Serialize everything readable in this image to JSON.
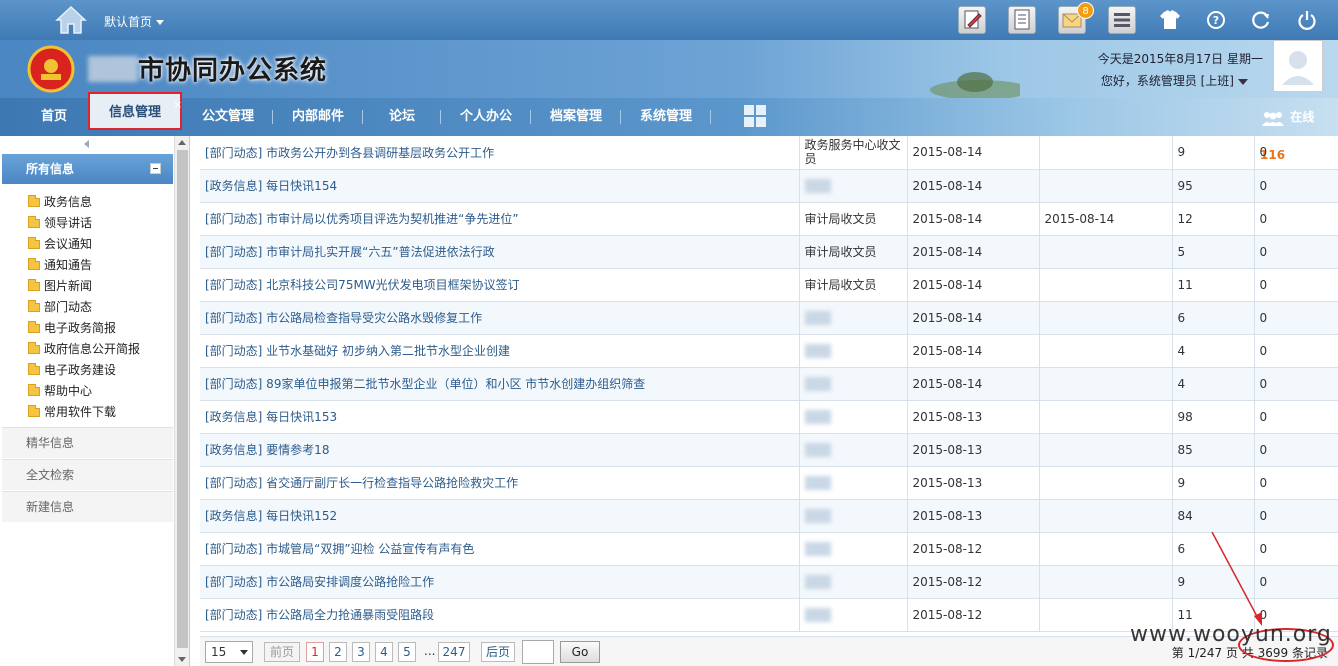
{
  "topbar": {
    "home_label": "默认首页",
    "mail_badge": "8"
  },
  "header": {
    "system_title": "市协同办公系统",
    "date_line": "今天是2015年8月17日 星期一",
    "user_line": "您好，系统管理员 [上班]"
  },
  "nav": {
    "items": [
      "首页",
      "信息管理",
      "公文管理",
      "内部邮件",
      "论坛",
      "个人办公",
      "档案管理",
      "系统管理"
    ],
    "active_close": "×",
    "online_label": "在线",
    "online_count": "116"
  },
  "sidebar": {
    "panel_title": "所有信息",
    "items": [
      "政务信息",
      "领导讲话",
      "会议通知",
      "通知通告",
      "图片新闻",
      "部门动态",
      "电子政务简报",
      "政府信息公开简报",
      "电子政务建设",
      "帮助中心",
      "常用软件下载"
    ],
    "sections": [
      "精华信息",
      "全文检索",
      "新建信息"
    ]
  },
  "table": {
    "rows": [
      {
        "title": "[部门动态] 市政务公开办到各县调研基层政务公开工作",
        "unit": "政务服务中心收文员",
        "date": "2015-08-14",
        "date2": "",
        "views": "9",
        "replies": "0"
      },
      {
        "title": "[政务信息] 每日快讯154",
        "unit": "",
        "date": "2015-08-14",
        "date2": "",
        "views": "95",
        "replies": "0"
      },
      {
        "title": "[部门动态] 市审计局以优秀项目评选为契机推进“争先进位”",
        "unit": "审计局收文员",
        "date": "2015-08-14",
        "date2": "2015-08-14",
        "views": "12",
        "replies": "0"
      },
      {
        "title": "[部门动态] 市审计局扎实开展“六五”普法促进依法行政",
        "unit": "审计局收文员",
        "date": "2015-08-14",
        "date2": "",
        "views": "5",
        "replies": "0"
      },
      {
        "title": "[部门动态] 北京科技公司75MW光伏发电项目框架协议签订",
        "unit": "审计局收文员",
        "date": "2015-08-14",
        "date2": "",
        "views": "11",
        "replies": "0"
      },
      {
        "title": "[部门动态] 市公路局检查指导受灾公路水毁修复工作",
        "unit": "",
        "date": "2015-08-14",
        "date2": "",
        "views": "6",
        "replies": "0"
      },
      {
        "title": "[部门动态] 业节水基础好 初步纳入第二批节水型企业创建",
        "unit": "",
        "date": "2015-08-14",
        "date2": "",
        "views": "4",
        "replies": "0"
      },
      {
        "title": "[部门动态] 89家单位申报第二批节水型企业（单位）和小区 市节水创建办组织筛查",
        "unit": "",
        "date": "2015-08-14",
        "date2": "",
        "views": "4",
        "replies": "0"
      },
      {
        "title": "[政务信息] 每日快讯153",
        "unit": "",
        "date": "2015-08-13",
        "date2": "",
        "views": "98",
        "replies": "0"
      },
      {
        "title": "[政务信息] 要情参考18",
        "unit": "",
        "date": "2015-08-13",
        "date2": "",
        "views": "85",
        "replies": "0"
      },
      {
        "title": "[部门动态] 省交通厅副厅长一行检查指导公路抢险救灾工作",
        "unit": "",
        "date": "2015-08-13",
        "date2": "",
        "views": "9",
        "replies": "0"
      },
      {
        "title": "[政务信息] 每日快讯152",
        "unit": "",
        "date": "2015-08-13",
        "date2": "",
        "views": "84",
        "replies": "0"
      },
      {
        "title": "[部门动态] 市城管局“双拥”迎检 公益宣传有声有色",
        "unit": "",
        "date": "2015-08-12",
        "date2": "",
        "views": "6",
        "replies": "0"
      },
      {
        "title": "[部门动态] 市公路局安排调度公路抢险工作",
        "unit": "",
        "date": "2015-08-12",
        "date2": "",
        "views": "9",
        "replies": "0"
      },
      {
        "title": "[部门动态] 市公路局全力抢通暴雨受阻路段",
        "unit": "",
        "date": "2015-08-12",
        "date2": "",
        "views": "11",
        "replies": "0"
      }
    ]
  },
  "pager": {
    "page_size": "15",
    "prev": "前页",
    "pages": [
      "1",
      "2",
      "3",
      "4",
      "5"
    ],
    "ellipsis": "...",
    "last_page": "247",
    "next": "后页",
    "go": "Go",
    "info": "第 1/247 页  共 3699 条记录"
  },
  "watermark": "www.wooyun.org",
  "colors": {
    "brand_blue": "#4a86c2",
    "highlight_red": "#e0242a",
    "link_blue": "#2d5c8c",
    "online_orange": "#e9731e"
  }
}
